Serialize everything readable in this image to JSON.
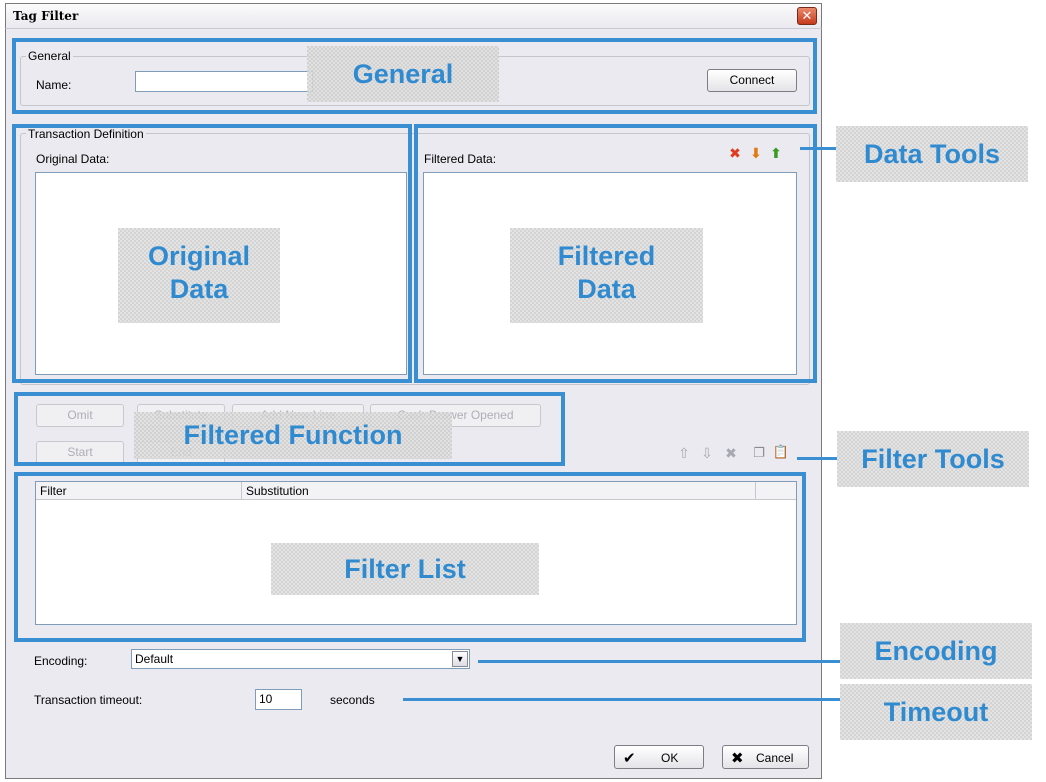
{
  "window": {
    "title": "Tag Filter",
    "close_glyph": "✕"
  },
  "general": {
    "group_label": "General",
    "name_label": "Name:",
    "name_value": "",
    "connect_label": "Connect"
  },
  "transaction": {
    "group_label": "Transaction Definition",
    "original_label": "Original Data:",
    "filtered_label": "Filtered Data:"
  },
  "data_tools": [
    {
      "name": "delete-icon",
      "glyph": "✖",
      "color": "#e23a1e"
    },
    {
      "name": "import-icon",
      "glyph": "⬇",
      "color": "#e07a10"
    },
    {
      "name": "export-icon",
      "glyph": "⬆",
      "color": "#3a9a22"
    }
  ],
  "functions": {
    "omit": "Omit",
    "substitute": "Substitute",
    "add_new_line": "Add New Line",
    "cash_drawer": "Cash Drawer Opened",
    "start": "Start",
    "end": "End"
  },
  "filter_tools": [
    {
      "name": "move-up-icon",
      "glyph": "⇧"
    },
    {
      "name": "move-down-icon",
      "glyph": "⇩"
    },
    {
      "name": "remove-icon",
      "glyph": "✖"
    },
    {
      "name": "copy-icon",
      "glyph": "❐"
    },
    {
      "name": "paste-icon",
      "glyph": "📋"
    }
  ],
  "filter_table": {
    "columns": [
      "Filter",
      "Substitution",
      ""
    ]
  },
  "encoding": {
    "label": "Encoding:",
    "value": "Default"
  },
  "timeout": {
    "label": "Transaction timeout:",
    "value": "10",
    "unit": "seconds"
  },
  "dialog": {
    "ok_label": "OK",
    "cancel_label": "Cancel",
    "ok_glyph": "✔",
    "cancel_glyph": "✖"
  },
  "annotations": {
    "general": "General",
    "original_l1": "Original",
    "original_l2": "Data",
    "filtered_l1": "Filtered",
    "filtered_l2": "Data",
    "filtered_function": "Filtered Function",
    "filter_list": "Filter List",
    "data_tools": "Data Tools",
    "filter_tools": "Filter Tools",
    "encoding": "Encoding",
    "timeout": "Timeout"
  },
  "colors": {
    "annotation_blue": "#3a8fd2",
    "window_bg": "#ebeaf0",
    "field_border": "#7f9db9"
  }
}
